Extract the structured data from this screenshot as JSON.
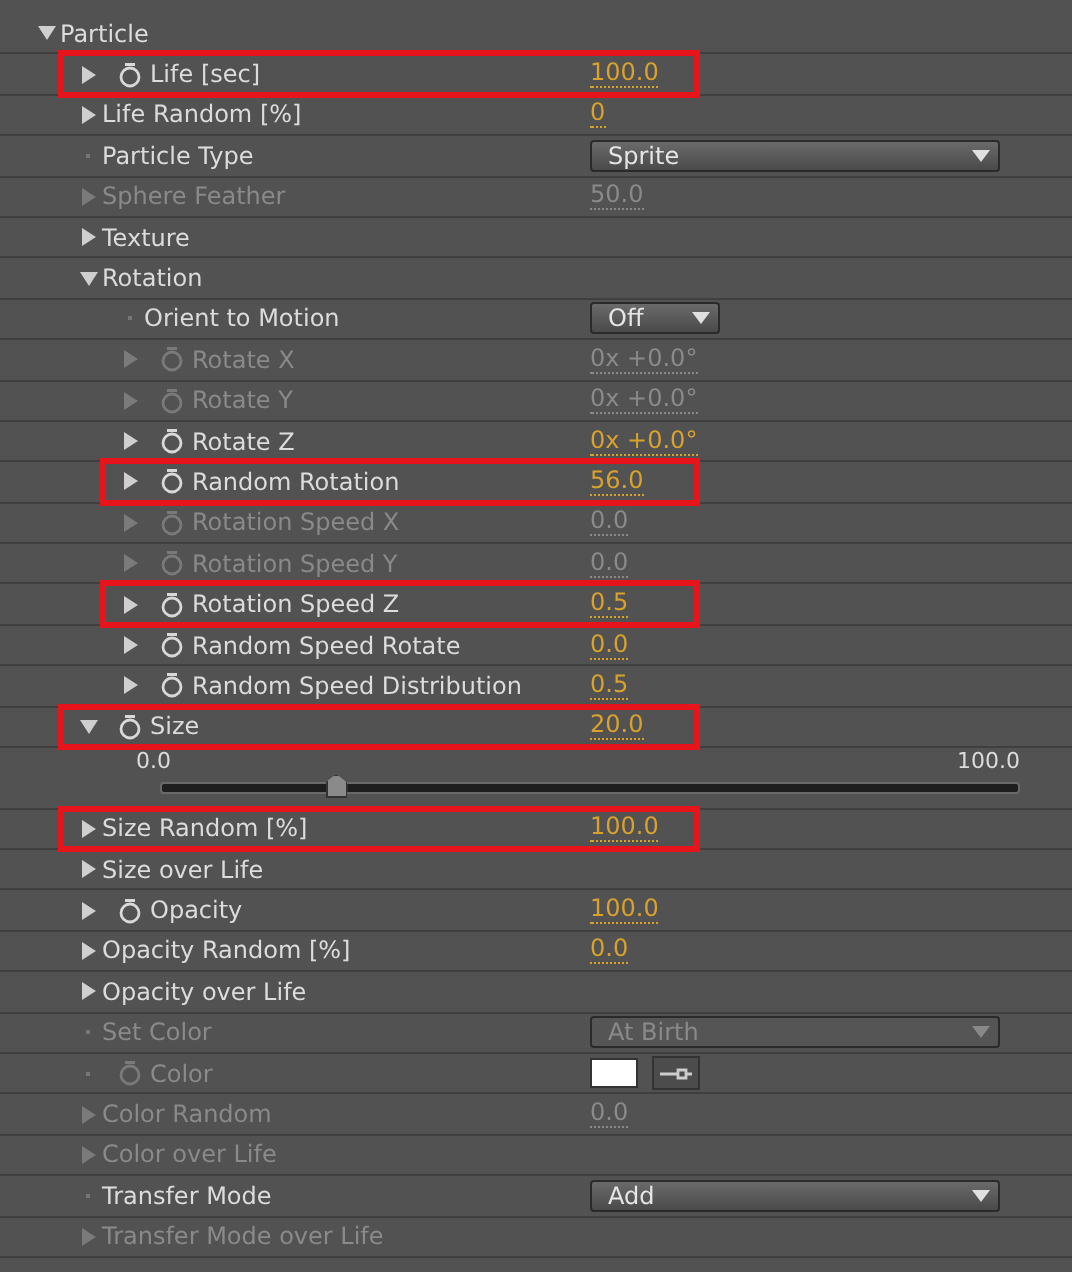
{
  "rows": [
    {
      "label": "Particle",
      "kind": "twirl",
      "expanded": true,
      "stopwatch": false,
      "disabled": false,
      "highlighted": false,
      "children": [
        {
          "label": "Life [sec]",
          "kind": "twirl",
          "expanded": false,
          "stopwatch": true,
          "disabled": false,
          "highlighted": true,
          "value": {
            "kind": "number",
            "text": "100.0"
          }
        },
        {
          "label": "Life Random [%]",
          "kind": "twirl",
          "expanded": false,
          "stopwatch": false,
          "disabled": false,
          "highlighted": false,
          "value": {
            "kind": "number",
            "text": "0"
          }
        },
        {
          "label": "Particle Type",
          "kind": "plain",
          "stopwatch": false,
          "disabled": false,
          "highlighted": false,
          "value": {
            "kind": "dropdown",
            "text": "Sprite"
          }
        },
        {
          "label": "Sphere Feather",
          "kind": "twirl",
          "expanded": false,
          "stopwatch": false,
          "disabled": true,
          "highlighted": false,
          "value": {
            "kind": "number",
            "text": "50.0"
          }
        },
        {
          "label": "Texture",
          "kind": "twirl",
          "expanded": false,
          "stopwatch": false,
          "disabled": false,
          "highlighted": false
        },
        {
          "label": "Rotation",
          "kind": "twirl",
          "expanded": true,
          "stopwatch": false,
          "disabled": false,
          "highlighted": false,
          "children": [
            {
              "label": "Orient to Motion",
              "kind": "plain",
              "stopwatch": false,
              "disabled": false,
              "highlighted": false,
              "value": {
                "kind": "short_dropdown",
                "text": "Off"
              }
            },
            {
              "label": "Rotate X",
              "kind": "twirl",
              "expanded": false,
              "stopwatch": true,
              "disabled": true,
              "highlighted": false,
              "value": {
                "kind": "number",
                "text": "0x +0.0°"
              }
            },
            {
              "label": "Rotate Y",
              "kind": "twirl",
              "expanded": false,
              "stopwatch": true,
              "disabled": true,
              "highlighted": false,
              "value": {
                "kind": "number",
                "text": "0x +0.0°"
              }
            },
            {
              "label": "Rotate Z",
              "kind": "twirl",
              "expanded": false,
              "stopwatch": true,
              "disabled": false,
              "highlighted": false,
              "value": {
                "kind": "number",
                "text": "0x +0.0°"
              }
            },
            {
              "label": "Random Rotation",
              "kind": "twirl",
              "expanded": false,
              "stopwatch": true,
              "disabled": false,
              "highlighted": true,
              "value": {
                "kind": "number",
                "text": "56.0"
              }
            },
            {
              "label": "Rotation Speed X",
              "kind": "twirl",
              "expanded": false,
              "stopwatch": true,
              "disabled": true,
              "highlighted": false,
              "value": {
                "kind": "number",
                "text": "0.0"
              }
            },
            {
              "label": "Rotation Speed Y",
              "kind": "twirl",
              "expanded": false,
              "stopwatch": true,
              "disabled": true,
              "highlighted": false,
              "value": {
                "kind": "number",
                "text": "0.0"
              }
            },
            {
              "label": "Rotation Speed Z",
              "kind": "twirl",
              "expanded": false,
              "stopwatch": true,
              "disabled": false,
              "highlighted": true,
              "value": {
                "kind": "number",
                "text": "0.5"
              }
            },
            {
              "label": "Random Speed Rotate",
              "kind": "twirl",
              "expanded": false,
              "stopwatch": true,
              "disabled": false,
              "highlighted": false,
              "value": {
                "kind": "number",
                "text": "0.0"
              }
            },
            {
              "label": "Random Speed Distribution",
              "kind": "twirl",
              "expanded": false,
              "stopwatch": true,
              "disabled": false,
              "highlighted": false,
              "value": {
                "kind": "number",
                "text": "0.5"
              }
            }
          ]
        },
        {
          "label": "Size",
          "kind": "twirl",
          "expanded": true,
          "stopwatch": true,
          "disabled": false,
          "highlighted": true,
          "value": {
            "kind": "number",
            "text": "20.0"
          },
          "slider": {
            "min": "0.0",
            "max": "100.0",
            "level": 0.2
          }
        },
        {
          "label": "Size Random [%]",
          "kind": "twirl",
          "expanded": false,
          "stopwatch": false,
          "disabled": false,
          "highlighted": true,
          "value": {
            "kind": "number",
            "text": "100.0"
          }
        },
        {
          "label": "Size over Life",
          "kind": "twirl",
          "expanded": false,
          "stopwatch": false,
          "disabled": false,
          "highlighted": false
        },
        {
          "label": "Opacity",
          "kind": "twirl",
          "expanded": false,
          "stopwatch": true,
          "disabled": false,
          "highlighted": false,
          "value": {
            "kind": "number",
            "text": "100.0"
          }
        },
        {
          "label": "Opacity Random [%]",
          "kind": "twirl",
          "expanded": false,
          "stopwatch": false,
          "disabled": false,
          "highlighted": false,
          "value": {
            "kind": "number",
            "text": "0.0"
          }
        },
        {
          "label": "Opacity over Life",
          "kind": "twirl",
          "expanded": false,
          "stopwatch": false,
          "disabled": false,
          "highlighted": false
        },
        {
          "label": "Set Color",
          "kind": "plain",
          "stopwatch": false,
          "disabled": true,
          "highlighted": false,
          "value": {
            "kind": "dropdown",
            "text": "At Birth"
          }
        },
        {
          "label": "Color",
          "kind": "plain",
          "stopwatch": true,
          "disabled": true,
          "highlighted": false,
          "value": {
            "kind": "color",
            "color": "#ffffff"
          }
        },
        {
          "label": "Color Random",
          "kind": "twirl",
          "expanded": false,
          "stopwatch": false,
          "disabled": true,
          "highlighted": false,
          "value": {
            "kind": "number",
            "text": "0.0"
          }
        },
        {
          "label": "Color over Life",
          "kind": "twirl",
          "expanded": false,
          "stopwatch": false,
          "disabled": true,
          "highlighted": false
        },
        {
          "label": "Transfer Mode",
          "kind": "plain",
          "stopwatch": false,
          "disabled": false,
          "highlighted": false,
          "value": {
            "kind": "dropdown",
            "text": "Add"
          }
        },
        {
          "label": "Transfer Mode over Life",
          "kind": "twirl",
          "expanded": false,
          "stopwatch": false,
          "disabled": true,
          "highlighted": false
        }
      ]
    }
  ]
}
